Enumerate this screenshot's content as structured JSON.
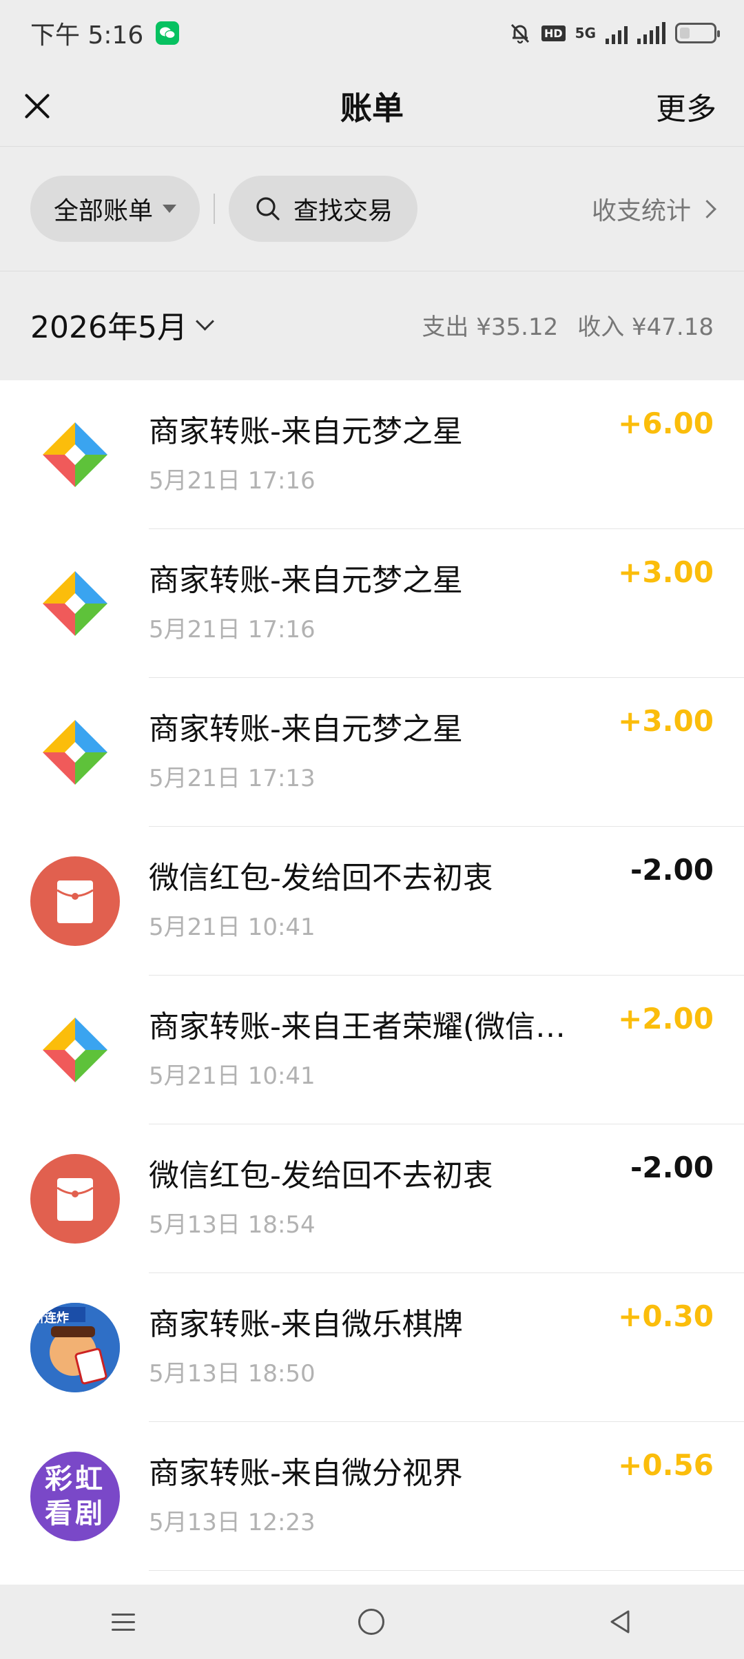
{
  "status_bar": {
    "time": "下午 5:16",
    "network": "5G",
    "hd": "HD"
  },
  "nav": {
    "title": "账单",
    "more": "更多"
  },
  "filters": {
    "all_label": "全部账单",
    "search_label": "查找交易",
    "stats_label": "收支统计"
  },
  "month_bar": {
    "month": "2026年5月",
    "expense": "支出 ¥35.12",
    "income": "收入 ¥47.18"
  },
  "transactions": [
    {
      "title": "商家转账-来自元梦之星",
      "time": "5月21日 17:16",
      "amount": "+6.00",
      "icon": "merchant-transfer-icon"
    },
    {
      "title": "商家转账-来自元梦之星",
      "time": "5月21日 17:16",
      "amount": "+3.00",
      "icon": "merchant-transfer-icon"
    },
    {
      "title": "商家转账-来自元梦之星",
      "time": "5月21日 17:13",
      "amount": "+3.00",
      "icon": "merchant-transfer-icon"
    },
    {
      "title": "微信红包-发给回不去初衷",
      "time": "5月21日 10:41",
      "amount": "-2.00",
      "icon": "red-packet-icon"
    },
    {
      "title": "商家转账-来自王者荣耀(微信…",
      "time": "5月21日 10:41",
      "amount": "+2.00",
      "icon": "merchant-transfer-icon"
    },
    {
      "title": "微信红包-发给回不去初衷",
      "time": "5月13日 18:54",
      "amount": "-2.00",
      "icon": "red-packet-icon"
    },
    {
      "title": "商家转账-来自微乐棋牌",
      "time": "5月13日 18:50",
      "amount": "+0.30",
      "icon": "game-avatar-icon",
      "icon_text": "新连炸"
    },
    {
      "title": "商家转账-来自微分视界",
      "time": "5月13日 12:23",
      "amount": "+0.56",
      "icon": "drama-app-icon",
      "icon_text": "彩虹看剧"
    }
  ],
  "colors": {
    "income": "#fbbd0b",
    "expense": "#111111",
    "red_packet": "#e1604f",
    "wechat": "#07c160"
  }
}
